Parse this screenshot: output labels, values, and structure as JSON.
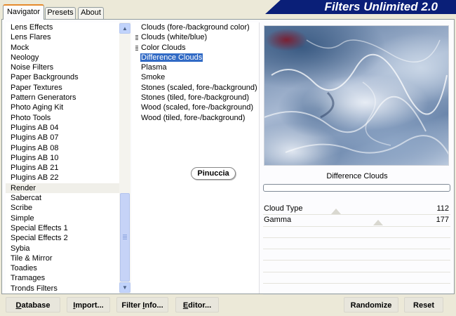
{
  "app": {
    "title": "Filters Unlimited 2.0"
  },
  "tabs": [
    {
      "label": "Navigator",
      "active": true
    },
    {
      "label": "Presets",
      "active": false
    },
    {
      "label": "About",
      "active": false
    }
  ],
  "categories": {
    "items": [
      "Lens Effects",
      "Lens Flares",
      "Mock",
      "Neology",
      "Noise Filters",
      "Paper Backgrounds",
      "Paper Textures",
      "Pattern Generators",
      "Photo Aging Kit",
      "Photo Tools",
      "Plugins AB 04",
      "Plugins AB 07",
      "Plugins AB 08",
      "Plugins AB 10",
      "Plugins AB 21",
      "Plugins AB 22",
      "Render",
      "Sabercat",
      "Scribe",
      "Simple",
      "Special Effects 1",
      "Special Effects 2",
      "Sybia",
      "Tile & Mirror",
      "Toadies",
      "Tramages",
      "Tronds Filters"
    ],
    "selected": "Render"
  },
  "filters": {
    "items": [
      {
        "label": "Clouds (fore-/background color)",
        "marked": false
      },
      {
        "label": "Clouds (white/blue)",
        "marked": true
      },
      {
        "label": "Color Clouds",
        "marked": true
      },
      {
        "label": "Difference Clouds",
        "marked": false
      },
      {
        "label": "Plasma",
        "marked": false
      },
      {
        "label": "Smoke",
        "marked": false
      },
      {
        "label": "Stones (scaled, fore-/background)",
        "marked": false
      },
      {
        "label": "Stones (tiled, fore-/background)",
        "marked": false
      },
      {
        "label": "Wood (scaled, fore-/background)",
        "marked": false
      },
      {
        "label": "Wood (tiled, fore-/background)",
        "marked": false
      }
    ],
    "selected": "Difference Clouds"
  },
  "watermark": {
    "text": "Pinuccia"
  },
  "preview": {
    "filter_name": "Difference Clouds",
    "progress": 0
  },
  "params": [
    {
      "name": "Cloud Type",
      "value": "112",
      "max": 255
    },
    {
      "name": "Gamma",
      "value": "177",
      "max": 255
    }
  ],
  "buttons": {
    "database": {
      "hot": "D",
      "rest": "atabase"
    },
    "import": {
      "hot": "I",
      "rest": "mport..."
    },
    "filter_info": {
      "pre": "Filter ",
      "hot": "I",
      "rest": "nfo..."
    },
    "editor": {
      "hot": "E",
      "rest": "ditor..."
    },
    "randomize": "Randomize",
    "reset": "Reset"
  },
  "colors": {
    "accent_tab": "#e68b2c",
    "selection": "#316ac5",
    "banner": "#0a1f78",
    "progress": "#2fa84a"
  }
}
